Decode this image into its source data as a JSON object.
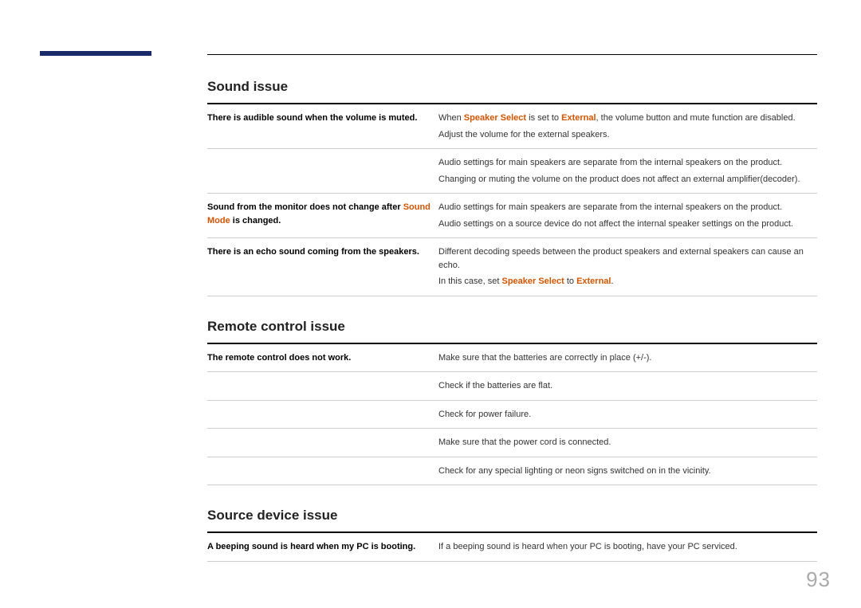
{
  "page_number": "93",
  "sections": {
    "sound": {
      "title": "Sound issue",
      "rows": [
        {
          "left": "There is audible sound when the volume is muted.",
          "right_parts": [
            {
              "t": "When "
            },
            {
              "t": "Speaker Select",
              "hl": true
            },
            {
              "t": " is set to "
            },
            {
              "t": "External",
              "hl": true
            },
            {
              "t": ", the volume button and mute function are disabled."
            }
          ],
          "right2": "Adjust the volume for the external speakers."
        },
        {
          "left": "",
          "right": "Audio settings for main speakers are separate from the internal speakers on the product.",
          "right2": "Changing or muting the volume on the product does not affect an external amplifier(decoder)."
        },
        {
          "left_parts": [
            {
              "t": "Sound from the monitor does not change after "
            },
            {
              "t": "Sound Mode",
              "hl": true
            },
            {
              "t": " is changed."
            }
          ],
          "right": "Audio settings for main speakers are separate from the internal speakers on the product.",
          "right2": "Audio settings on a source device do not affect the internal speaker settings on the product."
        },
        {
          "left": "There is an echo sound coming from the speakers.",
          "right": "Different decoding speeds between the product speakers and external speakers can cause an echo.",
          "right2_parts": [
            {
              "t": "In this case, set "
            },
            {
              "t": "Speaker Select",
              "hl": true
            },
            {
              "t": " to "
            },
            {
              "t": "External",
              "hl": true
            },
            {
              "t": "."
            }
          ]
        }
      ]
    },
    "remote": {
      "title": "Remote control issue",
      "left": "The remote control does not work.",
      "lines": [
        "Make sure that the batteries are correctly in place (+/-).",
        "Check if the batteries are flat.",
        "Check for power failure.",
        "Make sure that the power cord is connected.",
        "Check for any special lighting or neon signs switched on in the vicinity."
      ]
    },
    "source": {
      "title": "Source device issue",
      "left": "A beeping sound is heard when my PC is booting.",
      "right": "If a beeping sound is heard when your PC is booting, have your PC serviced."
    }
  }
}
